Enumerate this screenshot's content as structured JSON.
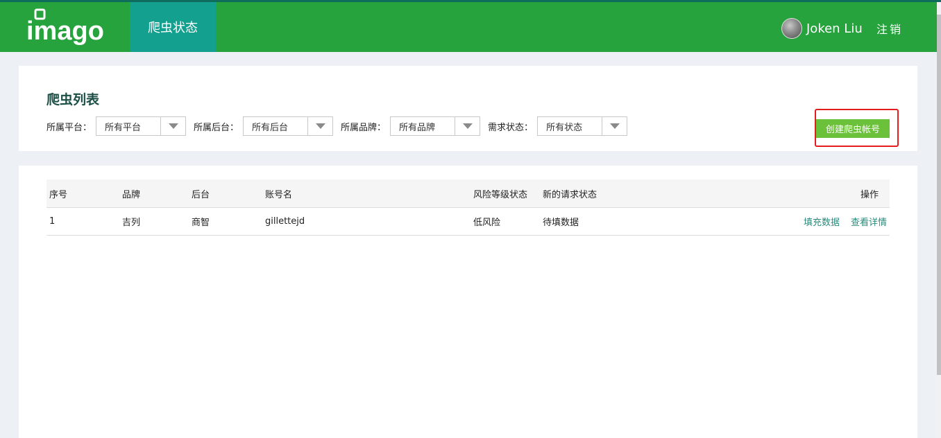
{
  "header": {
    "logo_text": "imago",
    "nav_tab": "爬虫状态",
    "username": "Joken Liu",
    "logout": "注销"
  },
  "filter_panel": {
    "title": "爬虫列表",
    "filters": [
      {
        "label": "所属平台：",
        "value": "所有平台"
      },
      {
        "label": "所属后台：",
        "value": "所有后台"
      },
      {
        "label": "所属品牌：",
        "value": "所有品牌"
      },
      {
        "label": "需求状态：",
        "value": "所有状态"
      }
    ],
    "create_button": "创建爬虫帐号"
  },
  "table": {
    "columns": [
      "序号",
      "品牌",
      "后台",
      "账号名",
      "风险等级状态",
      "新的请求状态",
      "操作"
    ],
    "rows": [
      {
        "cells": [
          "1",
          "吉列",
          "商智",
          "gillettejd",
          "低风险",
          "待填数据"
        ],
        "actions": [
          "填充数据",
          "查看详情"
        ]
      }
    ]
  },
  "colors": {
    "header_bg": "#26a33c",
    "nav_tab_bg": "#13a08f",
    "create_button_bg": "#6cc13a",
    "highlight_border": "#e61c1c",
    "link": "#2a8b7c"
  },
  "icons": [
    "avatar-image",
    "dropdown-arrow-icon"
  ]
}
